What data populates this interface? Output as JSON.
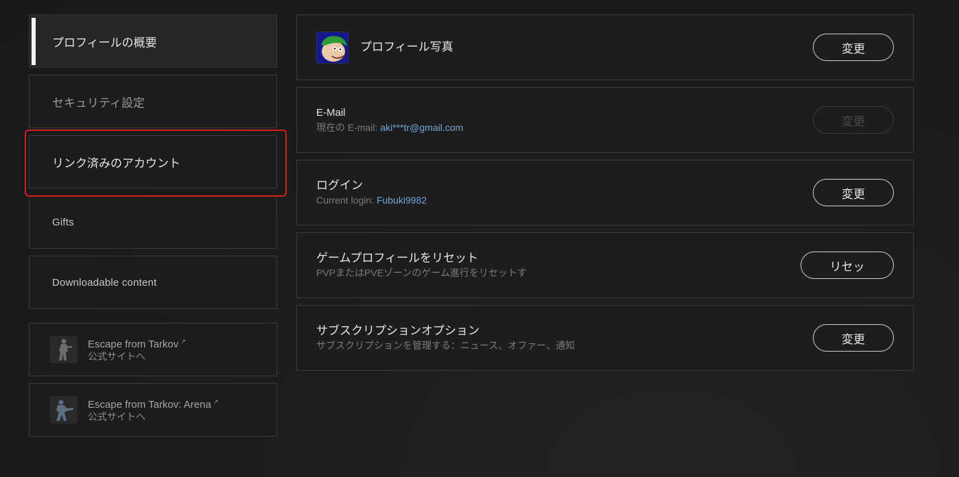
{
  "sidebar": {
    "items": [
      {
        "label": "プロフィールの概要"
      },
      {
        "label": "セキュリティ設定"
      },
      {
        "label": "リンク済みのアカウント"
      },
      {
        "label": "Gifts"
      },
      {
        "label": "Downloadable content"
      }
    ],
    "external": [
      {
        "title": "Escape from Tarkov",
        "sub": "公式サイトへ",
        "icon": "soldier-icon"
      },
      {
        "title": "Escape from Tarkov: Arena",
        "sub": "公式サイトへ",
        "icon": "arena-soldier-icon"
      }
    ]
  },
  "cards": {
    "photo": {
      "title": "プロフィール写真",
      "button": "変更"
    },
    "email": {
      "title": "E-Mail",
      "sub_prefix": "現在の E-mail:",
      "value": "aki***tr@gmail.com",
      "button": "変更"
    },
    "login": {
      "title": "ログイン",
      "sub_prefix": "Current login:",
      "value": "Fubuki9982",
      "button": "変更"
    },
    "reset": {
      "title": "ゲームプロフィールをリセット",
      "sub": "PVPまたはPVEゾーンのゲーム進行をリセットす",
      "button": "リセッ"
    },
    "subscription": {
      "title": "サブスクリプションオプション",
      "sub": "サブスクリプションを管理する：ニュース、オファー、通知",
      "button": "変更"
    }
  },
  "colors": {
    "accent_highlight": "#d81d1d",
    "link_value": "#6ea8d8"
  }
}
